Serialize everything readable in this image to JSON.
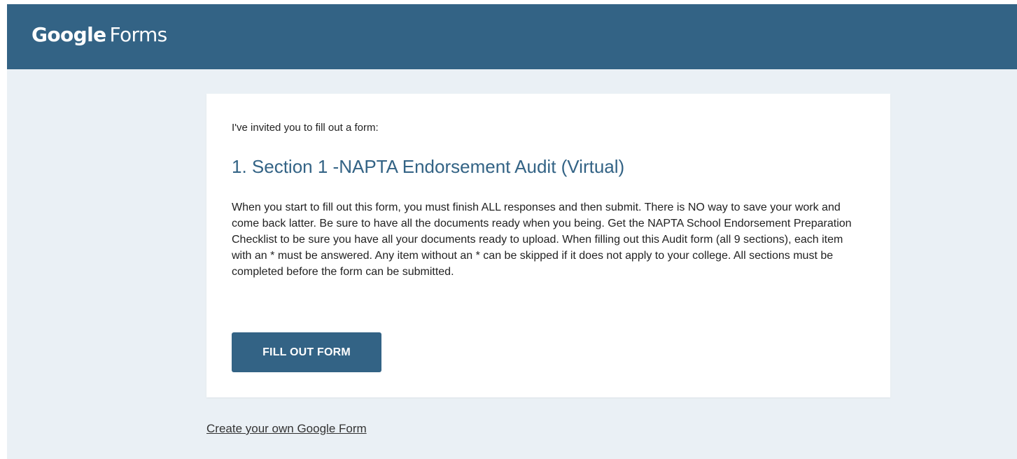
{
  "header": {
    "brand_google": "Google",
    "brand_product": "Forms"
  },
  "invitation": {
    "intro": "I've invited you to fill out a form:",
    "form_title": "1. Section 1 -NAPTA Endorsement Audit (Virtual)",
    "description": "When you start to fill out this form, you must finish ALL responses and then submit. There is NO way to save your work and come back latter. Be sure to have all the documents ready when you being. Get the NAPTA School Endorsement Preparation Checklist to be sure you have all your documents ready to upload. When filling out this Audit form (all 9 sections), each item with an * must be answered. Any item without an * can be skipped if it does not apply to your college. All sections must be completed before the form can be submitted.",
    "button_label": "FILL OUT FORM"
  },
  "footer": {
    "create_link": "Create your own Google Form"
  },
  "colors": {
    "header_background": "#336385",
    "page_background": "#eaf0f5",
    "accent": "#336385"
  }
}
